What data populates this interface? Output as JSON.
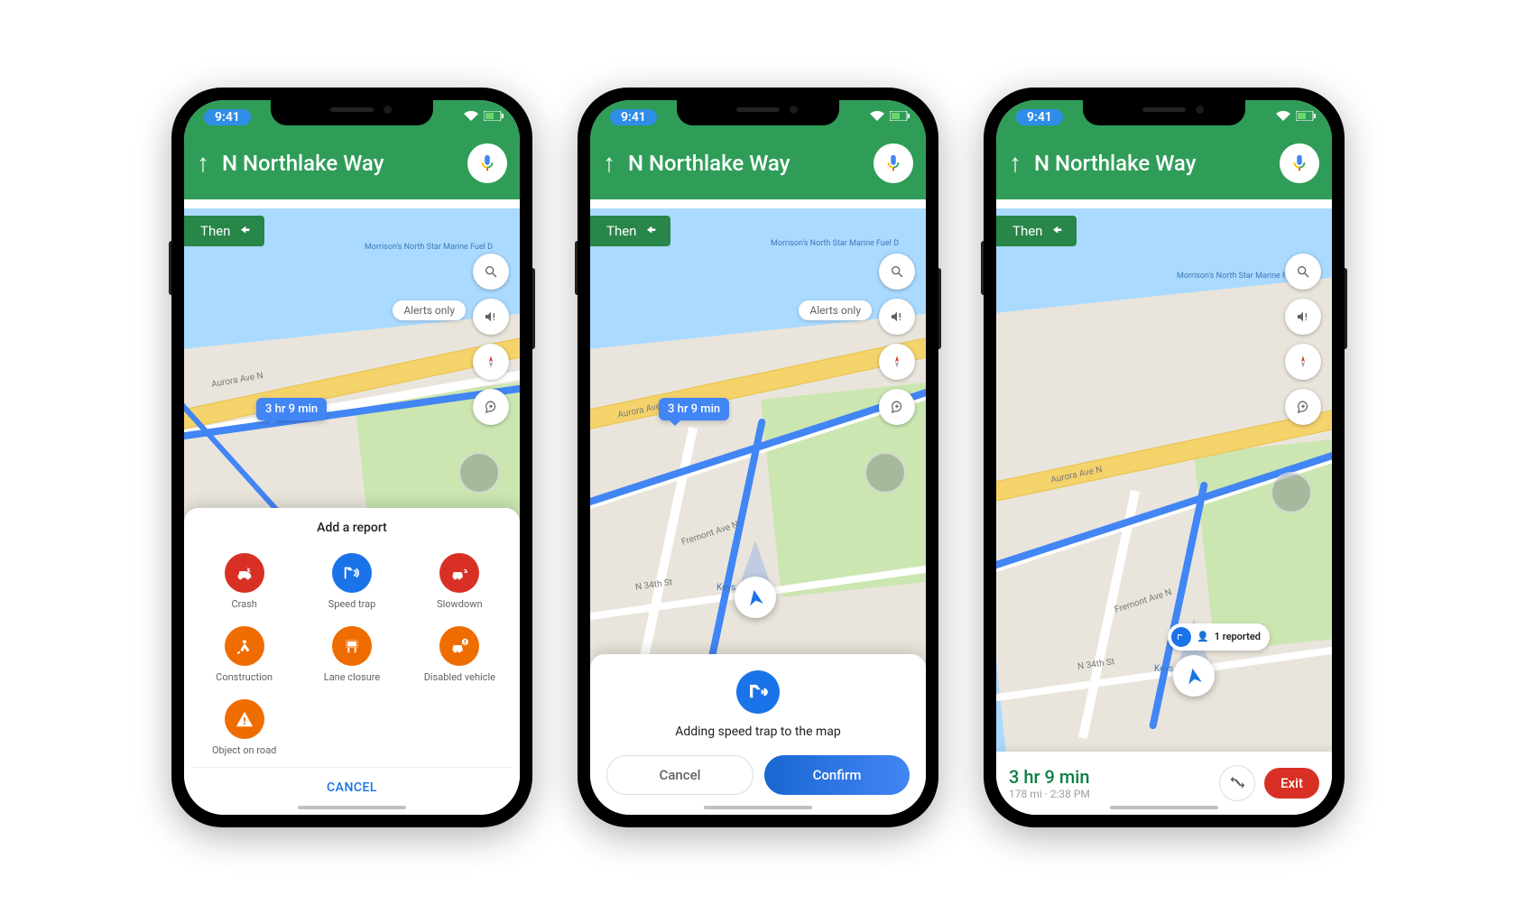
{
  "status": {
    "time": "9:41"
  },
  "header": {
    "direction_street": "N Northlake Way",
    "then": "Then"
  },
  "map": {
    "alerts_chip": "Alerts only",
    "eta_bubble": "3 hr 9 min",
    "road_labels": {
      "aurora": "Aurora Ave N",
      "fremont": "Fremont Ave N",
      "n34": "N 34th St"
    },
    "poi_labels": {
      "morrison": "Morrison's North Star\nMarine Fuel D",
      "keys": "Keys"
    }
  },
  "report_sheet": {
    "title": "Add a report",
    "items": [
      {
        "label": "Crash",
        "color": "#d93025",
        "icon": "car-crash"
      },
      {
        "label": "Speed trap",
        "color": "#1a73e8",
        "icon": "radar"
      },
      {
        "label": "Slowdown",
        "color": "#d93025",
        "icon": "car-slow"
      },
      {
        "label": "Construction",
        "color": "#ef6c00",
        "icon": "digger"
      },
      {
        "label": "Lane closure",
        "color": "#ef6c00",
        "icon": "sign"
      },
      {
        "label": "Disabled vehicle",
        "color": "#ef6c00",
        "icon": "car-alert"
      },
      {
        "label": "Object on road",
        "color": "#ef6c00",
        "icon": "hazard"
      }
    ],
    "cancel": "CANCEL"
  },
  "confirm_sheet": {
    "message": "Adding speed trap to the map",
    "cancel": "Cancel",
    "confirm": "Confirm"
  },
  "reported_chip": {
    "label": "1 reported"
  },
  "navbar": {
    "eta": "3 hr 9 min",
    "distance": "178 mi",
    "arrival": "2:38 PM",
    "exit": "Exit"
  }
}
